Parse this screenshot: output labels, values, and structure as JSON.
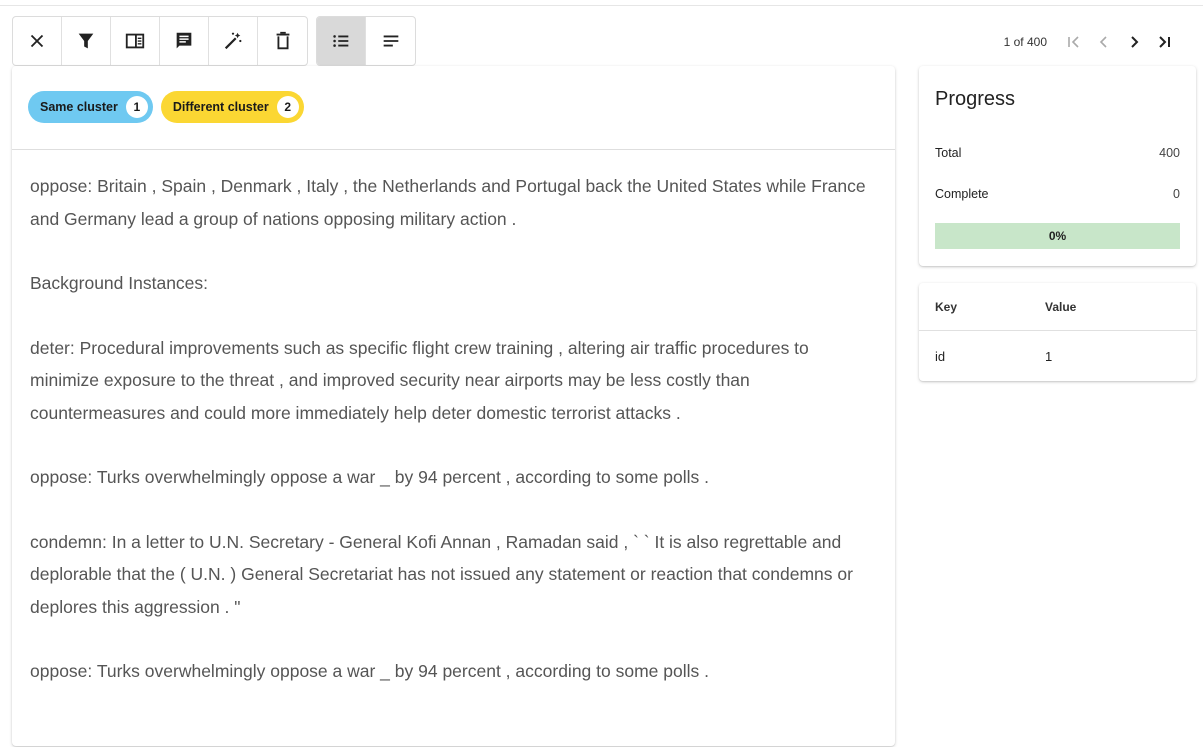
{
  "toolbar": {
    "buttons": [
      {
        "icon": "close-icon"
      },
      {
        "icon": "filter-icon"
      },
      {
        "icon": "panel-icon"
      },
      {
        "icon": "comment-icon"
      },
      {
        "icon": "magic-wand-icon"
      },
      {
        "icon": "delete-icon"
      },
      {
        "icon": "list-view-icon",
        "active": true
      },
      {
        "icon": "text-view-icon"
      }
    ]
  },
  "pager": {
    "count": "1 of 400"
  },
  "chips": [
    {
      "label": "Same cluster",
      "count": "1",
      "color": "#6fc9f1"
    },
    {
      "label": "Different cluster",
      "count": "2",
      "color": "#fbd733"
    }
  ],
  "content": {
    "p1": "oppose: Britain , Spain , Denmark , Italy , the Netherlands and Portugal back the United States while France and Germany lead a group of nations opposing military action .",
    "p2": "Background Instances:",
    "p3": "deter: Procedural improvements such as specific flight crew training , altering air traffic procedures to minimize exposure to the threat , and improved security near airports may be less costly than countermeasures and could more immediately help deter domestic terrorist attacks .",
    "p4": "oppose: Turks overwhelmingly oppose a war _ by 94 percent , according to some polls .",
    "p5": "condemn: In a letter to U.N. Secretary - General Kofi Annan , Ramadan said , ` ` It is also regrettable and deplorable that the ( U.N. ) General Secretariat has not issued any statement or reaction that condemns or deplores this aggression . \"",
    "p6": "oppose: Turks overwhelmingly oppose a war _ by 94 percent , according to some polls ."
  },
  "progress": {
    "title": "Progress",
    "total_label": "Total",
    "total_value": "400",
    "complete_label": "Complete",
    "complete_value": "0",
    "percent": "0%",
    "bar_color": "#c8e6c9"
  },
  "kv": {
    "key_header": "Key",
    "value_header": "Value",
    "rows": [
      {
        "key": "id",
        "value": "1"
      }
    ]
  }
}
